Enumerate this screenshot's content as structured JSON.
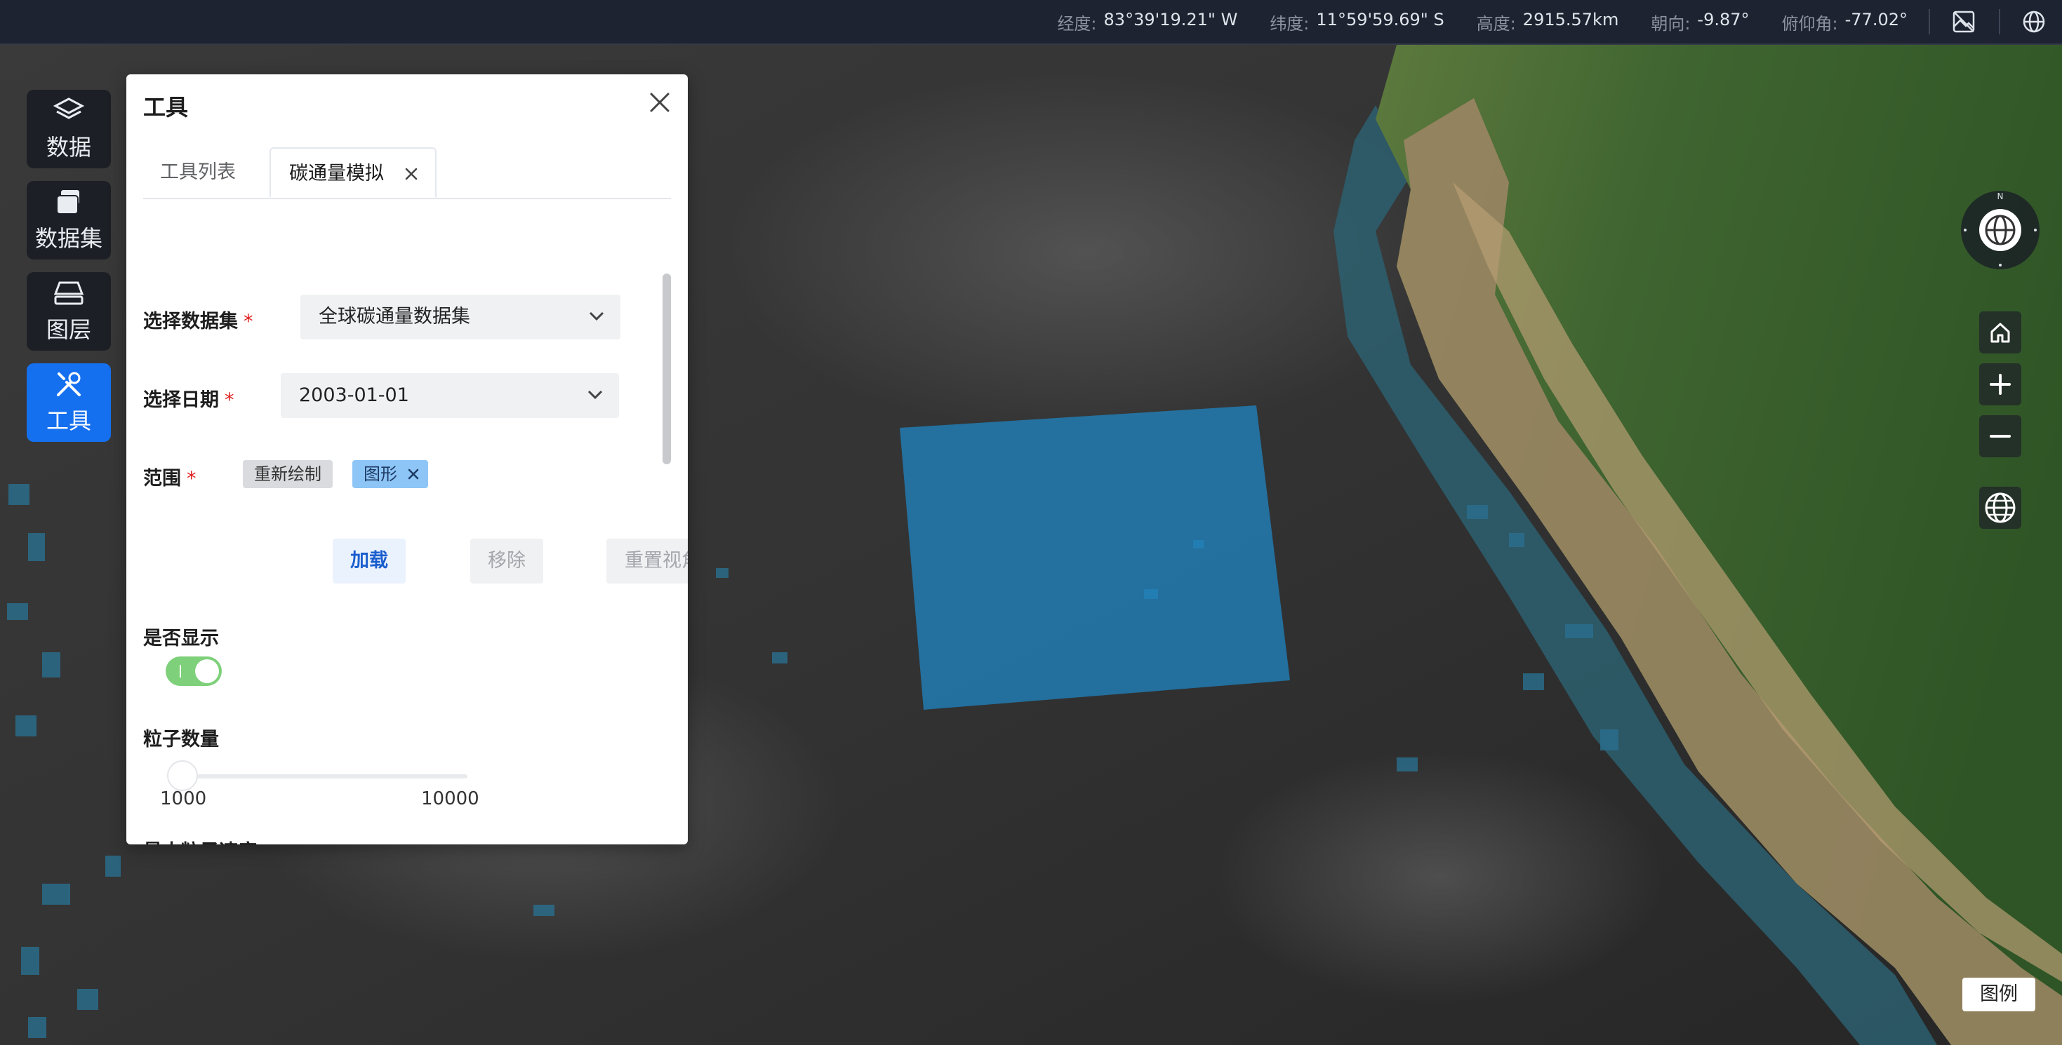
{
  "status_bar": {
    "longitude_label": "经度:",
    "longitude_value": "83°39'19.21\" W",
    "latitude_label": "纬度:",
    "latitude_value": "11°59'59.69\" S",
    "height_label": "高度:",
    "height_value": "2915.57km",
    "heading_label": "朝向:",
    "heading_value": "-9.87°",
    "pitch_label": "俯仰角:",
    "pitch_value": "-77.02°",
    "icons": [
      "map-layer-off-icon",
      "globe-language-icon"
    ]
  },
  "left_nav": {
    "items": [
      {
        "label": "数据",
        "icon": "layers-icon",
        "active": false
      },
      {
        "label": "数据集",
        "icon": "dataset-icon",
        "active": false
      },
      {
        "label": "图层",
        "icon": "layer-icon",
        "active": false
      },
      {
        "label": "工具",
        "icon": "tools-icon",
        "active": true
      }
    ]
  },
  "panel": {
    "title": "工具",
    "tabs": [
      {
        "label": "工具列表",
        "active": false
      },
      {
        "label": "碳通量模拟",
        "active": true,
        "closable": true
      }
    ],
    "form": {
      "dataset_label": "选择数据集",
      "dataset_value": "全球碳通量数据集",
      "date_label": "选择日期",
      "date_value": "2003-01-01",
      "range_label": "范围",
      "range_redraw": "重新绘制",
      "range_shape": "图形",
      "required_mark": "*",
      "load_button": "加载",
      "remove_button": "移除",
      "reset_view_button": "重置视角",
      "display_label": "是否显示",
      "display_on": true,
      "particle_count_label": "粒子数量",
      "particle_count_min": "1000",
      "particle_count_max": "10000",
      "particle_count_value": 1000,
      "max_speed_label": "最大粒子速度"
    }
  },
  "right_controls": {
    "compass_north": "N",
    "buttons": [
      "home-icon",
      "zoom-in-icon",
      "zoom-out-icon",
      "globe-icon"
    ]
  },
  "legend_button": "图例",
  "colors": {
    "accent": "#1570ef",
    "topbar": "#1d2330",
    "selection_fill": "#1e88c8",
    "switch_on": "#7ed07a"
  }
}
